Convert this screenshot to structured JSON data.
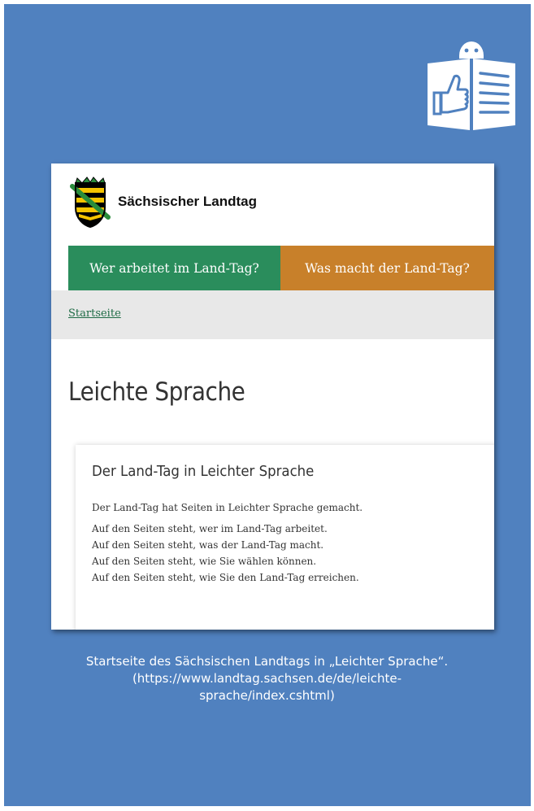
{
  "site": {
    "name": "Sächsischer Landtag",
    "nav": [
      {
        "label": "Wer arbeitet im Land-Tag?"
      },
      {
        "label": "Was macht der Land-Tag?"
      }
    ],
    "breadcrumb": "Startseite",
    "page_title": "Leichte Sprache",
    "card": {
      "title": "Der Land-Tag in Leichter Sprache",
      "intro": "Der Land-Tag hat Seiten in Leichter Sprache gemacht.",
      "lines": [
        "Auf den Seiten steht, wer im Land-Tag arbeitet.",
        "Auf den Seiten steht, was der Land-Tag macht.",
        "Auf den Seiten steht, wie Sie wählen können.",
        "Auf den Seiten steht, wie Sie den Land-Tag erreichen."
      ]
    }
  },
  "caption": {
    "line1": "Startseite des Sächsischen Landtags in „Leichter Sprache“.",
    "line2": "(https://www.landtag.sachsen.de/de/leichte-",
    "line3": "sprache/index.cshtml)"
  },
  "icons": {
    "easy_language": "easy-language-reading-person-icon",
    "crest": "saxony-coat-of-arms-icon"
  },
  "colors": {
    "panel_bg": "#5081bf",
    "nav_green": "#2a8d5c",
    "nav_orange": "#c8802a",
    "breadcrumb_bg": "#e8e8e8"
  }
}
